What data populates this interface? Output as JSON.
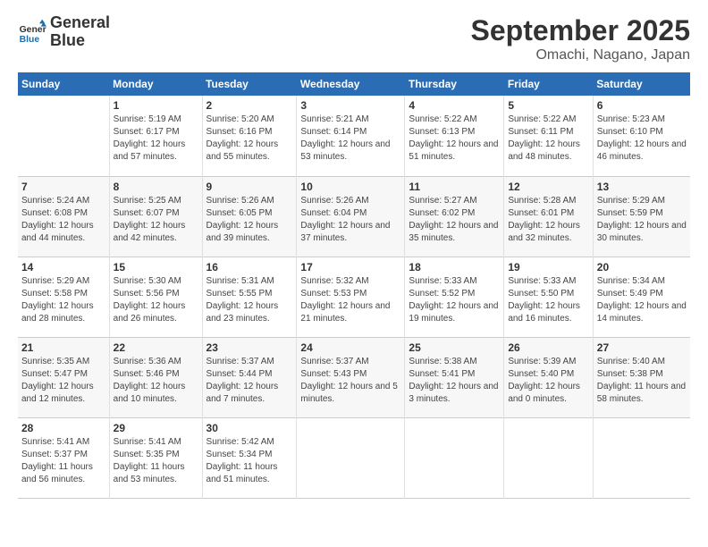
{
  "logo": {
    "line1": "General",
    "line2": "Blue"
  },
  "title": "September 2025",
  "subtitle": "Omachi, Nagano, Japan",
  "days_of_week": [
    "Sunday",
    "Monday",
    "Tuesday",
    "Wednesday",
    "Thursday",
    "Friday",
    "Saturday"
  ],
  "weeks": [
    [
      {
        "day": "",
        "content": ""
      },
      {
        "day": "1",
        "content": "Sunrise: 5:19 AM\nSunset: 6:17 PM\nDaylight: 12 hours\nand 57 minutes."
      },
      {
        "day": "2",
        "content": "Sunrise: 5:20 AM\nSunset: 6:16 PM\nDaylight: 12 hours\nand 55 minutes."
      },
      {
        "day": "3",
        "content": "Sunrise: 5:21 AM\nSunset: 6:14 PM\nDaylight: 12 hours\nand 53 minutes."
      },
      {
        "day": "4",
        "content": "Sunrise: 5:22 AM\nSunset: 6:13 PM\nDaylight: 12 hours\nand 51 minutes."
      },
      {
        "day": "5",
        "content": "Sunrise: 5:22 AM\nSunset: 6:11 PM\nDaylight: 12 hours\nand 48 minutes."
      },
      {
        "day": "6",
        "content": "Sunrise: 5:23 AM\nSunset: 6:10 PM\nDaylight: 12 hours\nand 46 minutes."
      }
    ],
    [
      {
        "day": "7",
        "content": "Sunrise: 5:24 AM\nSunset: 6:08 PM\nDaylight: 12 hours\nand 44 minutes."
      },
      {
        "day": "8",
        "content": "Sunrise: 5:25 AM\nSunset: 6:07 PM\nDaylight: 12 hours\nand 42 minutes."
      },
      {
        "day": "9",
        "content": "Sunrise: 5:26 AM\nSunset: 6:05 PM\nDaylight: 12 hours\nand 39 minutes."
      },
      {
        "day": "10",
        "content": "Sunrise: 5:26 AM\nSunset: 6:04 PM\nDaylight: 12 hours\nand 37 minutes."
      },
      {
        "day": "11",
        "content": "Sunrise: 5:27 AM\nSunset: 6:02 PM\nDaylight: 12 hours\nand 35 minutes."
      },
      {
        "day": "12",
        "content": "Sunrise: 5:28 AM\nSunset: 6:01 PM\nDaylight: 12 hours\nand 32 minutes."
      },
      {
        "day": "13",
        "content": "Sunrise: 5:29 AM\nSunset: 5:59 PM\nDaylight: 12 hours\nand 30 minutes."
      }
    ],
    [
      {
        "day": "14",
        "content": "Sunrise: 5:29 AM\nSunset: 5:58 PM\nDaylight: 12 hours\nand 28 minutes."
      },
      {
        "day": "15",
        "content": "Sunrise: 5:30 AM\nSunset: 5:56 PM\nDaylight: 12 hours\nand 26 minutes."
      },
      {
        "day": "16",
        "content": "Sunrise: 5:31 AM\nSunset: 5:55 PM\nDaylight: 12 hours\nand 23 minutes."
      },
      {
        "day": "17",
        "content": "Sunrise: 5:32 AM\nSunset: 5:53 PM\nDaylight: 12 hours\nand 21 minutes."
      },
      {
        "day": "18",
        "content": "Sunrise: 5:33 AM\nSunset: 5:52 PM\nDaylight: 12 hours\nand 19 minutes."
      },
      {
        "day": "19",
        "content": "Sunrise: 5:33 AM\nSunset: 5:50 PM\nDaylight: 12 hours\nand 16 minutes."
      },
      {
        "day": "20",
        "content": "Sunrise: 5:34 AM\nSunset: 5:49 PM\nDaylight: 12 hours\nand 14 minutes."
      }
    ],
    [
      {
        "day": "21",
        "content": "Sunrise: 5:35 AM\nSunset: 5:47 PM\nDaylight: 12 hours\nand 12 minutes."
      },
      {
        "day": "22",
        "content": "Sunrise: 5:36 AM\nSunset: 5:46 PM\nDaylight: 12 hours\nand 10 minutes."
      },
      {
        "day": "23",
        "content": "Sunrise: 5:37 AM\nSunset: 5:44 PM\nDaylight: 12 hours\nand 7 minutes."
      },
      {
        "day": "24",
        "content": "Sunrise: 5:37 AM\nSunset: 5:43 PM\nDaylight: 12 hours\nand 5 minutes."
      },
      {
        "day": "25",
        "content": "Sunrise: 5:38 AM\nSunset: 5:41 PM\nDaylight: 12 hours\nand 3 minutes."
      },
      {
        "day": "26",
        "content": "Sunrise: 5:39 AM\nSunset: 5:40 PM\nDaylight: 12 hours\nand 0 minutes."
      },
      {
        "day": "27",
        "content": "Sunrise: 5:40 AM\nSunset: 5:38 PM\nDaylight: 11 hours\nand 58 minutes."
      }
    ],
    [
      {
        "day": "28",
        "content": "Sunrise: 5:41 AM\nSunset: 5:37 PM\nDaylight: 11 hours\nand 56 minutes."
      },
      {
        "day": "29",
        "content": "Sunrise: 5:41 AM\nSunset: 5:35 PM\nDaylight: 11 hours\nand 53 minutes."
      },
      {
        "day": "30",
        "content": "Sunrise: 5:42 AM\nSunset: 5:34 PM\nDaylight: 11 hours\nand 51 minutes."
      },
      {
        "day": "",
        "content": ""
      },
      {
        "day": "",
        "content": ""
      },
      {
        "day": "",
        "content": ""
      },
      {
        "day": "",
        "content": ""
      }
    ]
  ]
}
